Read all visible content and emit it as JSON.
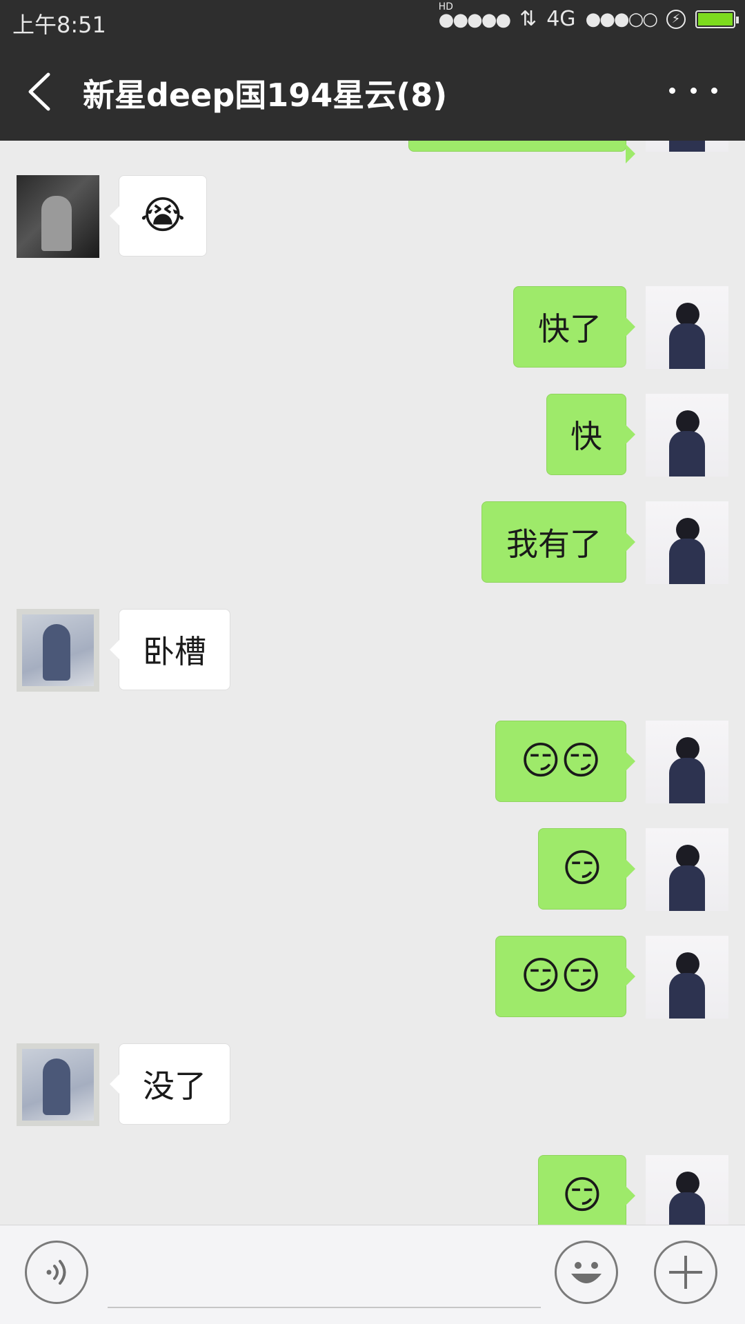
{
  "status_bar": {
    "time": "上午8:51",
    "hd_label": "HD",
    "signal1": "●●●●●",
    "data_arrows": "⇅",
    "network": "4G",
    "signal2": "●●●○○",
    "charging_icon": "charging-icon",
    "battery_level": 1.0,
    "battery_color": "#7ddb1e"
  },
  "header": {
    "title": "新星deep国194星云(8)",
    "back_icon": "chevron-left-icon",
    "more_icon": "more-dots-icon"
  },
  "messages": [
    {
      "side": "left",
      "avatar": "boy",
      "text": "😭"
    },
    {
      "side": "right",
      "avatar": "me",
      "text": "快了"
    },
    {
      "side": "right",
      "avatar": "me",
      "text": "快"
    },
    {
      "side": "right",
      "avatar": "me",
      "text": "我有了"
    },
    {
      "side": "left",
      "avatar": "girl",
      "text": "卧槽"
    },
    {
      "side": "right",
      "avatar": "me",
      "text": "😏😏"
    },
    {
      "side": "right",
      "avatar": "me",
      "text": "😏"
    },
    {
      "side": "right",
      "avatar": "me",
      "text": "😏😏"
    },
    {
      "side": "left",
      "avatar": "girl",
      "text": "没了"
    },
    {
      "side": "right",
      "avatar": "me",
      "text": "😏"
    }
  ],
  "input_bar": {
    "voice_icon": "voice-icon",
    "emoji_icon": "emoji-icon",
    "plus_icon": "plus-icon",
    "input_value": "",
    "input_placeholder": ""
  },
  "colors": {
    "header_bg": "#2e2e2e",
    "chat_bg": "#ebebeb",
    "bubble_right": "#9eea6a",
    "bubble_left": "#ffffff"
  }
}
